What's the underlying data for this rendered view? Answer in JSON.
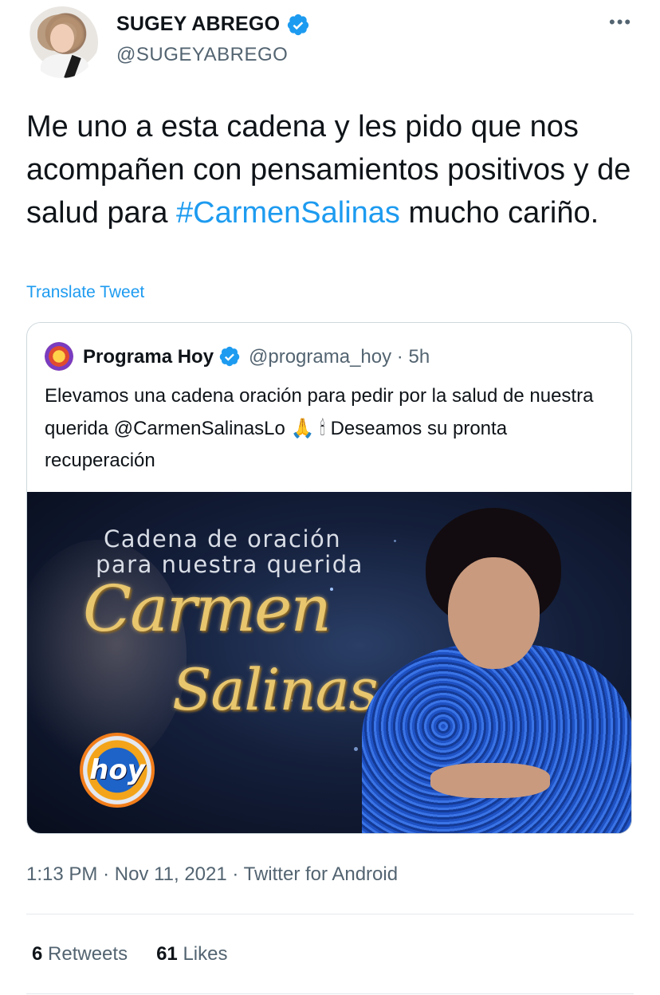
{
  "author": {
    "display_name": "SUGEY ABREGO",
    "handle": "@SUGEYABREGO"
  },
  "more_menu_glyph": "•••",
  "tweet": {
    "text_before_hashtag": "Me uno a esta cadena y les pido que nos acompañen con pensamientos positivos y de salud para ",
    "hashtag": "#CarmenSalinas",
    "text_after_hashtag": " mucho cariño."
  },
  "translate_label": "Translate Tweet",
  "quoted_tweet": {
    "display_name": "Programa Hoy",
    "handle": "@programa_hoy",
    "separator": "·",
    "time": "5h",
    "text_part1": "Elevamos una cadena oración para pedir por la salud de nuestra querida @CarmenSalinasLo ",
    "emoji_pray": "🙏",
    "emoji_candle": "🕯",
    "text_part2": " Deseamos su pronta recuperación",
    "image": {
      "line1": "Cadena de oración",
      "line2": "para nuestra querida",
      "name1": "Carmen",
      "name2": "Salinas",
      "logo": "hoy"
    }
  },
  "meta": {
    "time": "1:13 PM",
    "date": "Nov 11, 2021",
    "client": "Twitter for Android",
    "separator": "·"
  },
  "stats": {
    "retweets_count": "6",
    "retweets_label": "Retweets",
    "likes_count": "61",
    "likes_label": "Likes"
  },
  "colors": {
    "link_blue": "#1d9bf0",
    "secondary_text": "#536471",
    "primary_text": "#0f1419",
    "verified_blue": "#1d9bf0"
  }
}
